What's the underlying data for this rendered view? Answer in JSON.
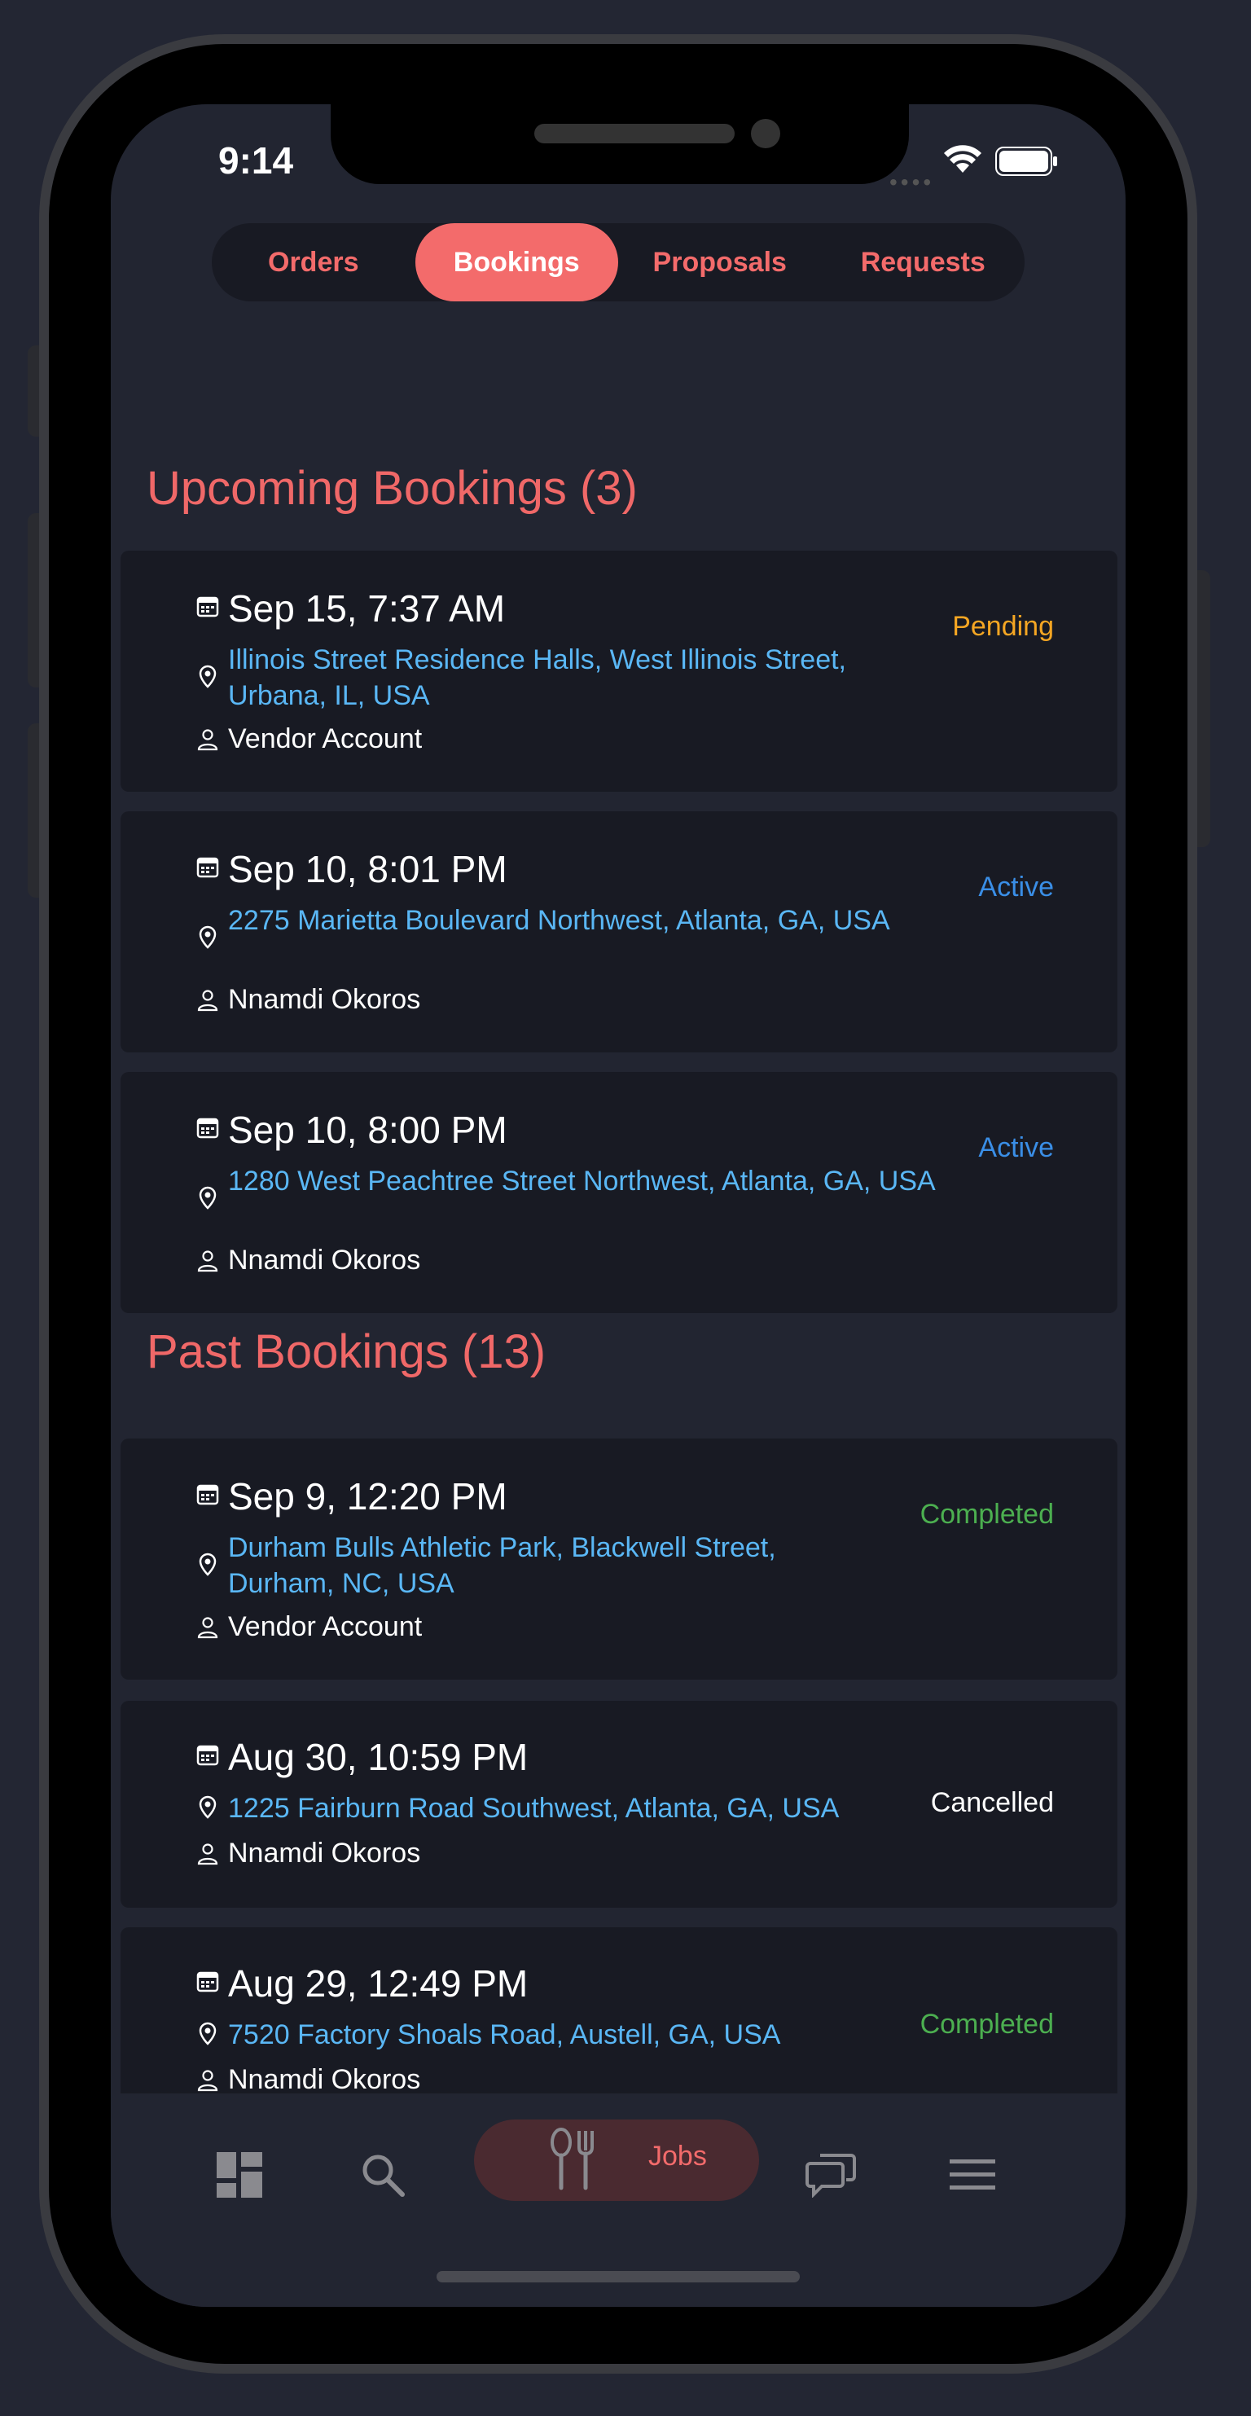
{
  "status_bar": {
    "time": "9:14"
  },
  "tabs": [
    {
      "label": "Orders"
    },
    {
      "label": "Bookings"
    },
    {
      "label": "Proposals"
    },
    {
      "label": "Requests"
    }
  ],
  "upcoming": {
    "title": "Upcoming Bookings (3)",
    "items": [
      {
        "date": "Sep 15, 7:37 AM",
        "location": "Illinois Street Residence Halls, West Illinois Street, Urbana, IL, USA",
        "person": "Vendor Account",
        "status": "Pending",
        "status_color": "#f5a623"
      },
      {
        "date": "Sep 10, 8:01 PM",
        "location": "2275 Marietta Boulevard Northwest, Atlanta, GA, USA",
        "person": "Nnamdi Okoros",
        "status": "Active",
        "status_color": "#3a8ee6"
      },
      {
        "date": "Sep 10, 8:00 PM",
        "location": "1280 West Peachtree Street Northwest, Atlanta, GA, USA",
        "person": "Nnamdi Okoros",
        "status": "Active",
        "status_color": "#3a8ee6"
      }
    ]
  },
  "past": {
    "title": "Past Bookings (13)",
    "items": [
      {
        "date": "Sep 9, 12:20 PM",
        "location": "Durham Bulls Athletic Park, Blackwell Street, Durham, NC, USA",
        "person": "Vendor Account",
        "status": "Completed",
        "status_color": "#4caf50"
      },
      {
        "date": "Aug 30, 10:59 PM",
        "location": "1225 Fairburn Road Southwest, Atlanta, GA, USA",
        "person": "Nnamdi Okoros",
        "status": "Cancelled",
        "status_color": "#ffffff"
      },
      {
        "date": "Aug 29, 12:49 PM",
        "location": "7520 Factory Shoals Road, Austell, GA, USA",
        "person": "Nnamdi Okoros",
        "status": "Completed",
        "status_color": "#4caf50"
      }
    ]
  },
  "bottom_nav": {
    "items": [
      "dashboard-icon",
      "search-icon",
      "utensils-icon",
      "chat-icon",
      "menu-icon"
    ],
    "jobs_label": "Jobs"
  },
  "colors": {
    "accent": "#f36b6b",
    "link": "#5ab7f5",
    "background": "#222531",
    "card": "#181a23"
  }
}
